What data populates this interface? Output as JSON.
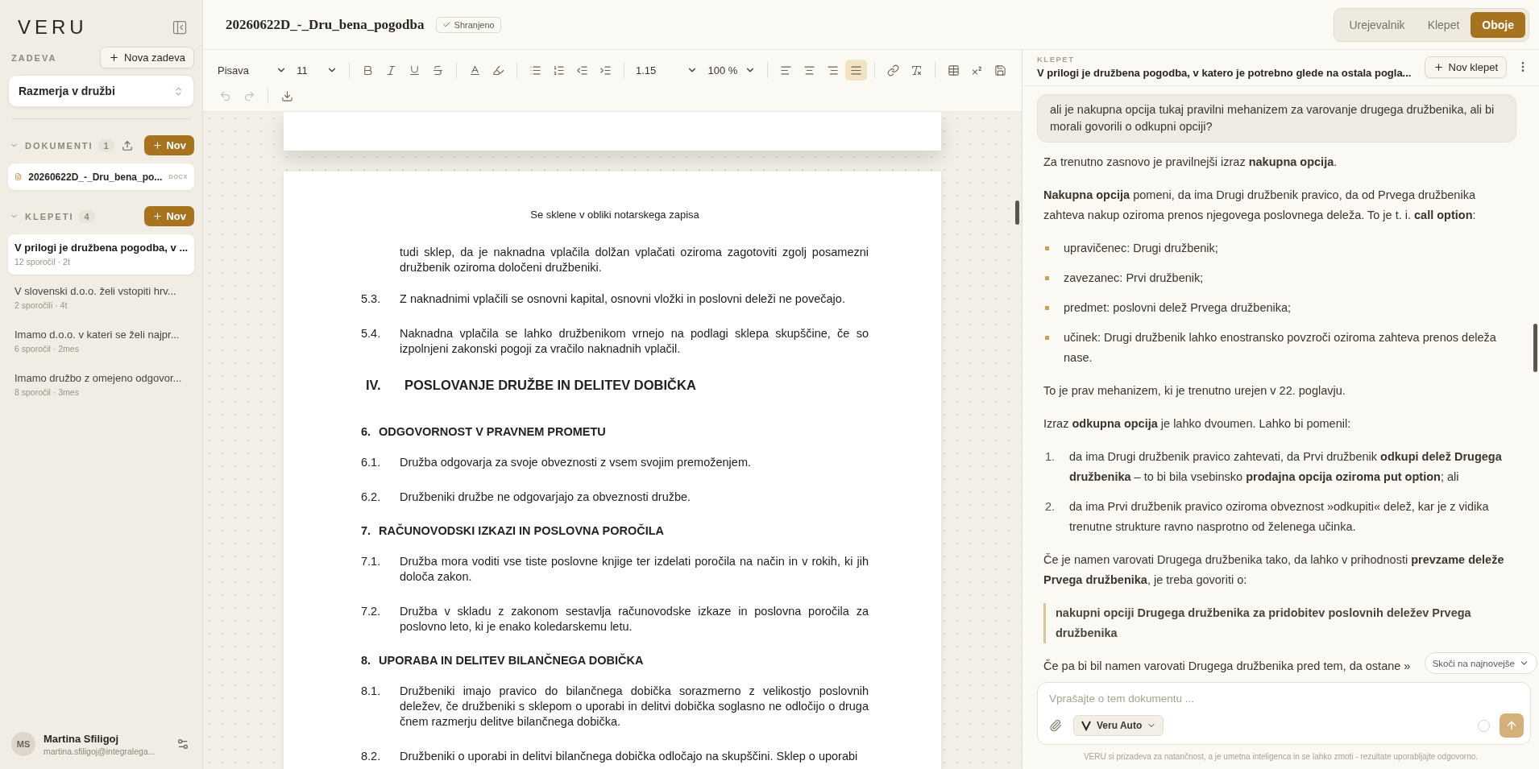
{
  "sidebar": {
    "logo": "VERU",
    "case_label": "ZADEVA",
    "new_case_button": "Nova zadeva",
    "case_select": "Razmerja v družbi",
    "documents": {
      "label": "DOKUMENTI",
      "count": "1",
      "expanded": true,
      "new_button": "Nov",
      "items": [
        {
          "name": "20260622D_-_Dru_bena_po...",
          "type": "DOCX"
        }
      ]
    },
    "chats": {
      "label": "KLEPETI",
      "count": "4",
      "expanded": true,
      "new_button": "Nov",
      "items": [
        {
          "title": "V prilogi je družbena pogodba, v ...",
          "meta": "12 sporočil · 2t",
          "selected": true
        },
        {
          "title": "V slovenski d.o.o. želi vstopiti hrv...",
          "meta": "2 sporočili · 4t",
          "selected": false
        },
        {
          "title": "Imamo d.o.o. v kateri se želi najpr...",
          "meta": "6 sporočil · 2mes",
          "selected": false
        },
        {
          "title": "Imamo družbo z omejeno odgovor...",
          "meta": "8 sporočil · 3mes",
          "selected": false
        }
      ]
    },
    "user": {
      "initials": "MS",
      "name": "Martina Sfiligoj",
      "email": "martina.sfiligoj@integralega..."
    }
  },
  "editor": {
    "title": "20260622D_-_Dru_bena_pogodba",
    "save_status": "Shranjeno",
    "toolbar": {
      "font": "Pisava",
      "size": "11",
      "line_spacing": "1.15",
      "zoom": "100 %",
      "alignment": [
        {
          "selected": false
        },
        {
          "selected": false
        },
        {
          "selected": false
        },
        {
          "selected": true
        }
      ],
      "undo_disabled": true,
      "redo_disabled": true
    },
    "document": {
      "blocks": [
        {
          "kind": "header",
          "text": "Se sklene v obliki notarskega zapisa"
        },
        {
          "kind": "continuation",
          "text": "tudi sklep, da je naknadna vplačila dolžan vplačati oziroma zagotoviti zgolj posamezni družbenik oziroma določeni družbeniki."
        },
        {
          "kind": "item",
          "number": "5.3.",
          "text": "Z naknadnimi vplačili se osnovni kapital, osnovni vložki in poslovni deleži ne povečajo."
        },
        {
          "kind": "item",
          "number": "5.4.",
          "text": "Naknadna vplačila se lahko družbenikom vrnejo na podlagi sklepa skupščine, če so izpolnjeni zakonski pogoji za vračilo naknadnih vplačil."
        },
        {
          "kind": "chapter",
          "number": "IV.",
          "text": "POSLOVANJE DRUŽBE IN DELITEV DOBIČKA"
        },
        {
          "kind": "section",
          "number": "6.",
          "text": "ODGOVORNOST V PRAVNEM PROMETU"
        },
        {
          "kind": "item",
          "number": "6.1.",
          "text": "Družba odgovarja za svoje obveznosti z vsem svojim premoženjem."
        },
        {
          "kind": "item",
          "number": "6.2.",
          "text": "Družbeniki družbe ne odgovarjajo za obveznosti družbe."
        },
        {
          "kind": "section",
          "number": "7.",
          "text": "RAČUNOVODSKI IZKAZI IN POSLOVNA POROČILA"
        },
        {
          "kind": "item",
          "number": "7.1.",
          "text": "Družba mora voditi vse tiste poslovne knjige ter izdelati poročila na način in v rokih, ki jih določa zakon."
        },
        {
          "kind": "item",
          "number": "7.2.",
          "text": "Družba v skladu z zakonom sestavlja računovodske izkaze in poslovna poročila za poslovno leto, ki je enako koledarskemu letu."
        },
        {
          "kind": "section",
          "number": "8.",
          "text": "UPORABA IN DELITEV BILANČNEGA DOBIČKA"
        },
        {
          "kind": "item",
          "number": "8.1.",
          "text": "Družbeniki imajo pravico do bilančnega dobička sorazmerno z velikostjo poslovnih deležev, če družbeniki s sklepom o uporabi in delitvi dobička soglasno ne odločijo o druga čnem razmerju delitve bilančnega dobička."
        },
        {
          "kind": "item",
          "number": "8.2.",
          "text": "Družbeniki o uporabi in delitvi bilančnega dobička odločajo na skupščini. Sklep o uporabi"
        }
      ]
    }
  },
  "view_tabs": [
    {
      "label": "Urejevalnik",
      "selected": false
    },
    {
      "label": "Klepet",
      "selected": false
    },
    {
      "label": "Oboje",
      "selected": true
    }
  ],
  "chat": {
    "label": "KLEPET",
    "title": "V prilogi je družbena pogodba, v katero je potrebno glede na ostala pogla...",
    "new_chat_button": "Nov klepet",
    "messages": [
      {
        "kind": "question",
        "text": "ali je nakupna opcija tukaj pravilni mehanizem za varovanje drugega družbenika, ali bi morali govorili o odkupni opciji?"
      },
      {
        "kind": "answer",
        "blocks": [
          {
            "kind": "paragraph",
            "text": "Za trenutno zasnovo je pravilnejši izraz **nakupna opcija**."
          },
          {
            "kind": "paragraph",
            "text": "**Nakupna opcija** pomeni, da ima Drugi družbenik pravico, da od Prvega družbenika zahteva nakup oziroma prenos njegovega poslovnega deleža. To je t. i. **call option**:"
          },
          {
            "kind": "bullets",
            "items": [
              "upravičenec: Drugi družbenik;",
              "zavezanec: Prvi družbenik;",
              "predmet: poslovni delež Prvega družbenika;",
              "učinek: Drugi družbenik lahko enostransko povzroči oziroma zahteva prenos deleža nase."
            ]
          },
          {
            "kind": "paragraph",
            "text": "To je prav mehanizem, ki je trenutno urejen v 22. poglavju."
          },
          {
            "kind": "paragraph",
            "text": "Izraz **odkupna opcija** je lahko dvoumen. Lahko bi pomenil:"
          },
          {
            "kind": "numbered",
            "items": [
              {
                "number": "1.",
                "text": "da ima Drugi družbenik pravico zahtevati, da Prvi družbenik **odkupi delež Drugega družbenika** – to bi bila vsebinsko **prodajna opcija oziroma put option**; ali"
              },
              {
                "number": "2.",
                "text": "da ima Prvi družbenik pravico oziroma obveznost »odkupiti« delež, kar je z vidika trenutne strukture ravno nasprotno od želenega učinka."
              }
            ]
          },
          {
            "kind": "paragraph",
            "text": "Če je namen varovati Drugega družbenika tako, da lahko v prihodnosti **prevzame deleže Prvega družbenika**, je treba govoriti o:"
          },
          {
            "kind": "quote",
            "text": "nakupni opciji Drugega družbenika za pridobitev poslovnih deležev Prvega družbenika"
          },
          {
            "kind": "paragraph",
            "text": "Če pa bi bil namen varovati Drugega družbenika pred tem, da ostane »"
          }
        ]
      }
    ],
    "jump_button": "Skoči na najnovejše",
    "input": {
      "placeholder": "Vprašajte o tem dokumentu ...",
      "model": "Veru Auto"
    },
    "disclaimer": "VERU si prizadeva za natančnost, a je umetna inteligenca in se lahko zmoti - rezultate uporabljajte odgovorno."
  }
}
